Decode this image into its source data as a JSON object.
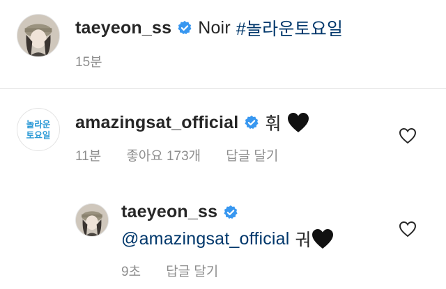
{
  "caption": {
    "username": "taeyeon_ss",
    "text": "Noir",
    "hashtag": "#놀라운토요일",
    "time": "15분"
  },
  "comment": {
    "username": "amazingsat_official",
    "avatar_text": "놀라운토요일",
    "text": "훠",
    "time": "11분",
    "likes": "좋아요 173개",
    "reply_label": "답글 달기"
  },
  "reply": {
    "username": "taeyeon_ss",
    "mention": "@amazingsat_official",
    "text": "궈",
    "time": "9초",
    "reply_label": "답글 달기"
  },
  "colors": {
    "verified": "#3897f0",
    "link": "#00376b",
    "muted": "#8e8e8e"
  },
  "icons": [
    "verified-badge-icon",
    "black-heart-emoji-icon",
    "like-heart-icon"
  ]
}
